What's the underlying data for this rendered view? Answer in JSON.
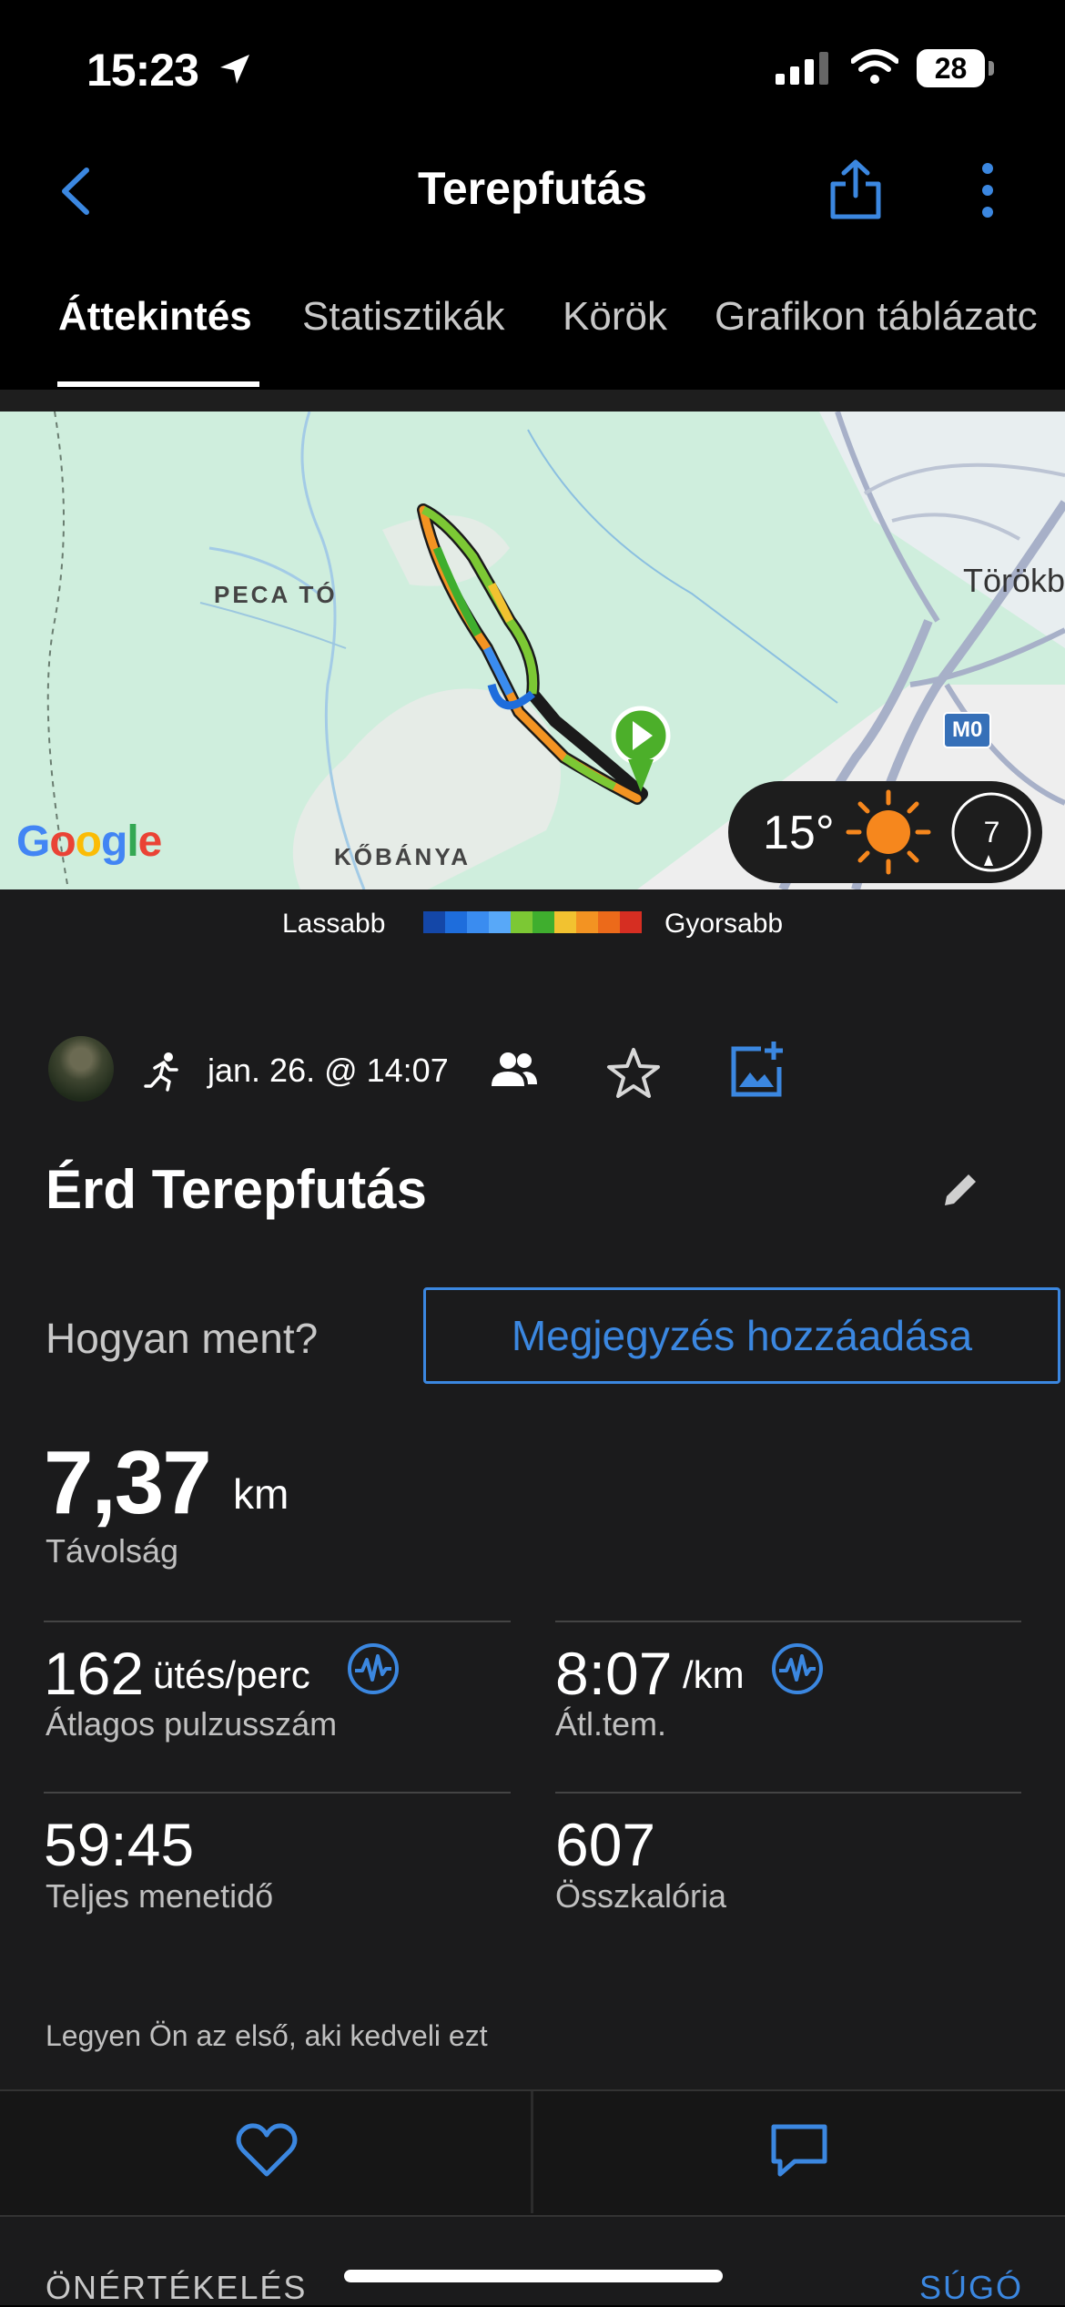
{
  "status_bar": {
    "time": "15:23",
    "battery": "28"
  },
  "nav": {
    "title": "Terepfutás"
  },
  "tabs": [
    "Áttekintés",
    "Statisztikák",
    "Körök",
    "Grafikon táblázatc"
  ],
  "map": {
    "labels": {
      "peca_to": "PECA TÓ",
      "kobanya": "KŐBÁNYA",
      "torokbalint": "Törökb",
      "m0": "M0"
    },
    "google": "Google",
    "weather": {
      "temp": "15°",
      "wind": "7"
    }
  },
  "legend": {
    "slow": "Lassabb",
    "fast": "Gyorsabb",
    "colors": [
      "#1447a8",
      "#1e6ddc",
      "#3a8cf0",
      "#58a8f8",
      "#7cc834",
      "#3fae2e",
      "#f2c230",
      "#f39322",
      "#ec6a1a",
      "#d62e22"
    ]
  },
  "activity": {
    "date": "jan. 26. @ 14:07",
    "title": "Érd Terepfutás",
    "how_label": "Hogyan ment?",
    "note_button": "Megjegyzés hozzáadása"
  },
  "stats": {
    "distance": {
      "value": "7,37",
      "unit": "km",
      "label": "Távolság"
    },
    "heart_rate": {
      "value": "162",
      "unit": "ütés/perc",
      "label": "Átlagos pulzusszám"
    },
    "pace": {
      "value": "8:07",
      "unit": "/km",
      "label": "Átl.tem."
    },
    "time": {
      "value": "59:45",
      "label": "Teljes menetidő"
    },
    "calories": {
      "value": "607",
      "label": "Összkalória"
    }
  },
  "likes_text": "Legyen Ön az első, aki kedveli ezt",
  "footer": {
    "self_eval": "ÖNÉRTÉKELÉS",
    "help": "SÚGÓ"
  },
  "colors": {
    "accent": "#3b87e0",
    "background": "#1b1b1c"
  }
}
